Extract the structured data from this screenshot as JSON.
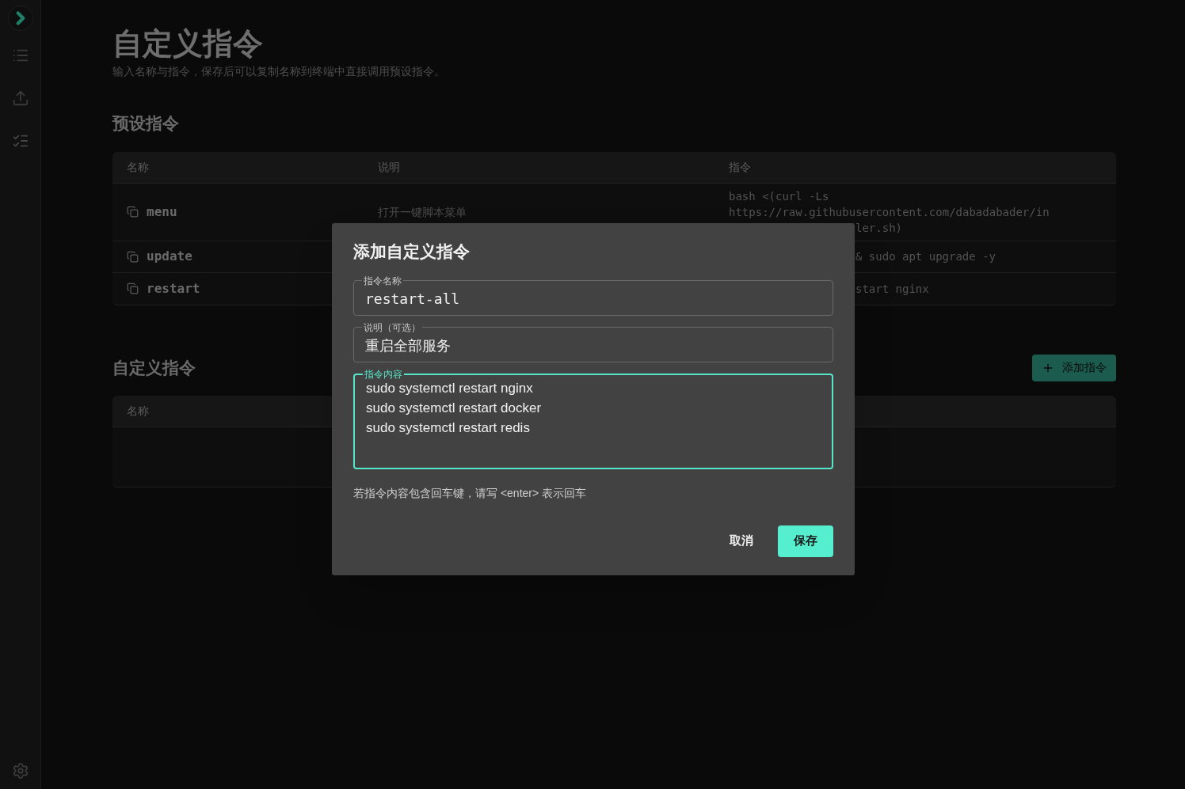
{
  "page": {
    "title": "自定义指令",
    "subtitle": "输入名称与指令，保存后可以复制名称到终端中直接调用预设指令。"
  },
  "preset": {
    "heading": "预设指令",
    "columns": [
      "名称",
      "说明",
      "指令"
    ],
    "rows": [
      {
        "name": "menu",
        "description": "打开一键脚本菜单",
        "command": [
          {
            "text": "bash <(curl -Ls",
            "clipped": false
          },
          {
            "text": "https://raw.githubusercontent.com/dabadabader/in",
            "clipped": false
          },
          {
            "text": "ler.sh)",
            "clipped": true
          }
        ]
      },
      {
        "name": "update",
        "command": [
          {
            "text": "& sudo apt upgrade -y",
            "clipped": true
          }
        ]
      },
      {
        "name": "restart",
        "command": [
          {
            "text": "start nginx",
            "clipped": true
          }
        ]
      }
    ]
  },
  "custom": {
    "heading": "自定义指令",
    "add_button": "添加指令",
    "columns": [
      "名称"
    ]
  },
  "dialog": {
    "title": "添加自定义指令",
    "fields": [
      {
        "kind": "input",
        "label": "指令名称",
        "value": "restart-all",
        "focused": false
      },
      {
        "kind": "input",
        "label": "说明（可选）",
        "value": "重启全部服务",
        "focused": false
      },
      {
        "kind": "textarea",
        "label": "指令内容",
        "value": "sudo systemctl restart nginx\nsudo systemctl restart docker\nsudo systemctl restart redis",
        "focused": true
      }
    ],
    "hint": "若指令内容包含回车键，请写 <enter> 表示回车",
    "cancel": "取消",
    "save": "保存"
  }
}
